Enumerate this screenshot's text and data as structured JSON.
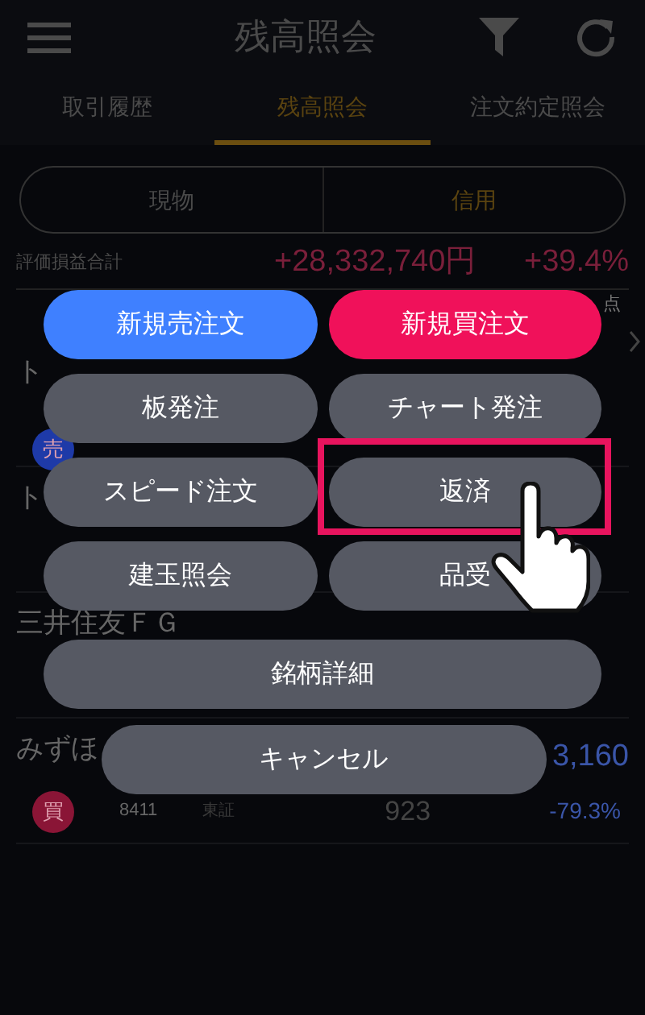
{
  "header": {
    "title": "残高照会"
  },
  "tabs": [
    {
      "label": "取引履歴",
      "selected": false
    },
    {
      "label": "残高照会",
      "selected": true
    },
    {
      "label": "注文約定照会",
      "selected": false
    }
  ],
  "segment": [
    {
      "label": "現物",
      "selected": false
    },
    {
      "label": "信用",
      "selected": true
    }
  ],
  "summary": {
    "label": "評価損益合計",
    "amount": "+28,332,740円",
    "percent": "+39.4%"
  },
  "list_header": {
    "column_3": "点"
  },
  "rows": [
    {
      "name": "ト",
      "badge": "売",
      "color": "#1e3aa8"
    },
    {
      "name": "ト"
    },
    {
      "name": "三井住友ＦＧ"
    },
    {
      "name": "みずほ",
      "badge": "買",
      "color": "#8a1536",
      "code": "8411",
      "market": "東証",
      "price": "923",
      "value": "3,160",
      "percent": "-79.3%"
    }
  ],
  "menu": [
    {
      "label": "新規売注文",
      "kind": "sell",
      "highlighted": false
    },
    {
      "label": "新規買注文",
      "kind": "buy",
      "highlighted": false
    },
    {
      "label": "板発注",
      "kind": "normal",
      "highlighted": false
    },
    {
      "label": "チャート発注",
      "kind": "normal",
      "highlighted": false
    },
    {
      "label": "スピード注文",
      "kind": "normal",
      "highlighted": false
    },
    {
      "label": "返済",
      "kind": "normal",
      "highlighted": true
    },
    {
      "label": "建玉照会",
      "kind": "normal",
      "highlighted": false
    },
    {
      "label": "品受",
      "kind": "normal",
      "highlighted": false
    }
  ],
  "detail_button": "銘柄詳細",
  "cancel_button": "キャンセル"
}
